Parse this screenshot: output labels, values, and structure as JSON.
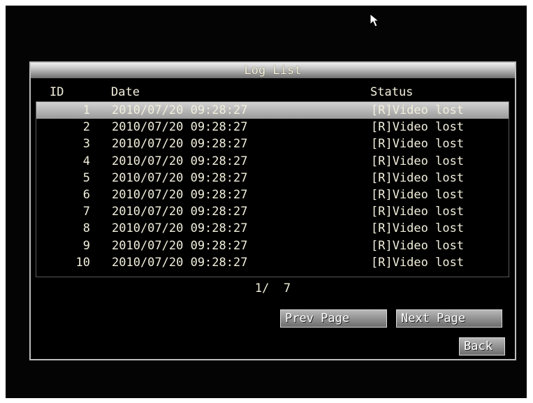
{
  "dialog": {
    "title": "Log List"
  },
  "table": {
    "columns": {
      "id": "ID",
      "date": "Date",
      "status": "Status"
    },
    "rows": [
      {
        "id": "1",
        "date": "2010/07/20 09:28:27",
        "status": "[R]Video lost",
        "selected": true
      },
      {
        "id": "2",
        "date": "2010/07/20 09:28:27",
        "status": "[R]Video lost"
      },
      {
        "id": "3",
        "date": "2010/07/20 09:28:27",
        "status": "[R]Video lost"
      },
      {
        "id": "4",
        "date": "2010/07/20 09:28:27",
        "status": "[R]Video lost"
      },
      {
        "id": "5",
        "date": "2010/07/20 09:28:27",
        "status": "[R]Video lost"
      },
      {
        "id": "6",
        "date": "2010/07/20 09:28:27",
        "status": "[R]Video lost"
      },
      {
        "id": "7",
        "date": "2010/07/20 09:28:27",
        "status": "[R]Video lost"
      },
      {
        "id": "8",
        "date": "2010/07/20 09:28:27",
        "status": "[R]Video lost"
      },
      {
        "id": "9",
        "date": "2010/07/20 09:28:27",
        "status": "[R]Video lost"
      },
      {
        "id": "10",
        "date": "2010/07/20 09:28:27",
        "status": "[R]Video lost"
      }
    ]
  },
  "pagination": {
    "indicator": "1/  7",
    "prev_label": "Prev Page",
    "next_label": "Next Page"
  },
  "actions": {
    "back_label": "Back"
  },
  "icons": {
    "cursor": "mouse-pointer-icon"
  }
}
